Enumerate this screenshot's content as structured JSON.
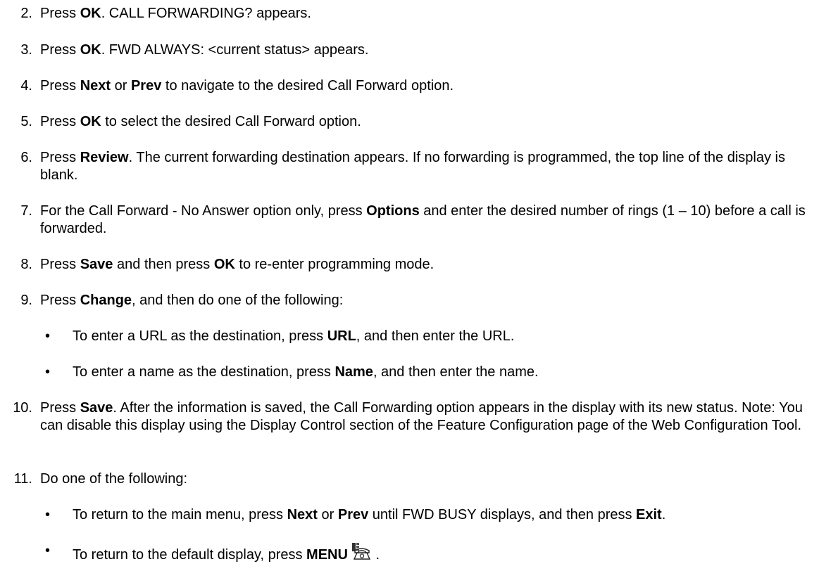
{
  "steps": [
    {
      "num": "2.",
      "parts": [
        [
          "t",
          "Press "
        ],
        [
          "b",
          "OK"
        ],
        [
          "t",
          ".  CALL FORWARDING? appears."
        ]
      ]
    },
    {
      "num": "3.",
      "parts": [
        [
          "t",
          "Press "
        ],
        [
          "b",
          "OK"
        ],
        [
          "t",
          ". FWD ALWAYS: <current status> appears."
        ]
      ]
    },
    {
      "num": "4.",
      "parts": [
        [
          "t",
          "Press "
        ],
        [
          "b",
          "Next"
        ],
        [
          "t",
          " or "
        ],
        [
          "b",
          "Prev"
        ],
        [
          "t",
          " to navigate to the desired Call Forward option."
        ]
      ]
    },
    {
      "num": "5.",
      "parts": [
        [
          "t",
          "Press "
        ],
        [
          "b",
          "OK"
        ],
        [
          "t",
          " to select the desired Call Forward option."
        ]
      ]
    },
    {
      "num": "6.",
      "parts": [
        [
          "t",
          "Press "
        ],
        [
          "b",
          "Review"
        ],
        [
          "t",
          ". The current forwarding destination appears. If no forwarding is programmed, the top line of the display is blank."
        ]
      ]
    },
    {
      "num": "7.",
      "parts": [
        [
          "t",
          "For the Call Forward - No Answer option only, press "
        ],
        [
          "b",
          "Options"
        ],
        [
          "t",
          " and enter the desired number of rings (1 – 10) before a call is forwarded."
        ]
      ]
    },
    {
      "num": "8.",
      "parts": [
        [
          "t",
          "Press "
        ],
        [
          "b",
          "Save"
        ],
        [
          "t",
          " and then press "
        ],
        [
          "b",
          "OK"
        ],
        [
          "t",
          " to re-enter programming mode."
        ]
      ]
    },
    {
      "num": "9.",
      "parts": [
        [
          "t",
          "Press "
        ],
        [
          "b",
          "Change"
        ],
        [
          "t",
          ", and then do one of the following:"
        ]
      ]
    },
    {
      "num": "10.",
      "parts": [
        [
          "t",
          "Press "
        ],
        [
          "b",
          "Save"
        ],
        [
          "t",
          ". After the information is saved, the Call Forwarding option appears in the display with its new status. Note: You can disable this display using the Display Control section of the Feature Configuration page of the Web Configuration Tool."
        ]
      ]
    },
    {
      "num": "11.",
      "parts": [
        [
          "t",
          "Do one of the following:"
        ]
      ]
    }
  ],
  "step9_bullets": [
    {
      "parts": [
        [
          "t",
          "To enter a URL as the destination, press "
        ],
        [
          "b",
          "URL"
        ],
        [
          "t",
          ", and then enter the URL."
        ]
      ]
    },
    {
      "parts": [
        [
          "t",
          "To enter a name as the destination, press "
        ],
        [
          "b",
          "Name"
        ],
        [
          "t",
          ", and then enter the name."
        ]
      ]
    }
  ],
  "step11_bullets": [
    {
      "parts": [
        [
          "t",
          "To return to the main menu, press "
        ],
        [
          "b",
          "Next"
        ],
        [
          "t",
          " or "
        ],
        [
          "b",
          "Prev"
        ],
        [
          "t",
          " until FWD BUSY displays, and then press "
        ],
        [
          "b",
          "Exit"
        ],
        [
          "t",
          "."
        ]
      ]
    },
    {
      "parts": [
        [
          "t",
          "To return to the default display, press "
        ],
        [
          "b",
          "MENU"
        ],
        [
          "i",
          "menu-phone-icon"
        ],
        [
          "t",
          " ."
        ]
      ]
    }
  ],
  "bullet_glyph": "•"
}
